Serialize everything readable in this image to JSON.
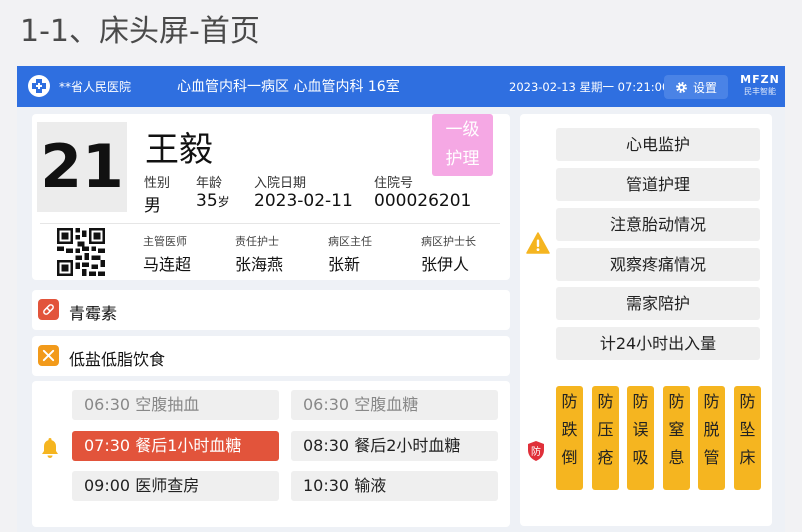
{
  "page_heading": "1-1、床头屏-首页",
  "topbar": {
    "hospital": "**省人民医院",
    "ward": "心血管内科一病区  心血管内科 16室",
    "datetime": "2023-02-13 星期一 07:21:00",
    "settings_label": "设置",
    "brand_main": "MFZN",
    "brand_sub": "民丰智能"
  },
  "patient": {
    "bed_number": "21",
    "name": "王毅",
    "care_level_line1": "一级",
    "care_level_line2": "护理",
    "gender_label": "性别",
    "gender": "男",
    "age_label": "年龄",
    "age": "35",
    "age_unit": "岁",
    "admit_label": "入院日期",
    "admit_date": "2023-02-11",
    "inpatient_label": "住院号",
    "inpatient_no": "000026201"
  },
  "staff": [
    {
      "label": "主管医师",
      "name": "马连超"
    },
    {
      "label": "责任护士",
      "name": "张海燕"
    },
    {
      "label": "病区主任",
      "name": "张新"
    },
    {
      "label": "病区护士长",
      "name": "张伊人"
    }
  ],
  "allergy": {
    "text": "青霉素",
    "icon": "pill-icon",
    "color": "#e2543b"
  },
  "diet": {
    "text": "低盐低脂饮食",
    "icon": "utensils-icon",
    "color": "#f29a1a"
  },
  "schedule": [
    {
      "text": "06:30 空腹抽血",
      "state": "done"
    },
    {
      "text": "06:30 空腹血糖",
      "state": "done"
    },
    {
      "text": "07:30 餐后1小时血糖",
      "state": "current"
    },
    {
      "text": "08:30 餐后2小时血糖",
      "state": "upcoming"
    },
    {
      "text": "09:00 医师查房",
      "state": "upcoming"
    },
    {
      "text": "10:30 输液",
      "state": "upcoming"
    }
  ],
  "care_items": [
    "心电监护",
    "管道护理",
    "注意胎动情况",
    "观察疼痛情况",
    "需家陪护",
    "计24小时出入量"
  ],
  "shield_label": "防",
  "prevention": [
    [
      "防",
      "跌",
      "倒"
    ],
    [
      "防",
      "压",
      "疮"
    ],
    [
      "防",
      "误",
      "吸"
    ],
    [
      "防",
      "窒",
      "息"
    ],
    [
      "防",
      "脱",
      "管"
    ],
    [
      "防",
      "坠",
      "床"
    ]
  ],
  "colors": {
    "topbar": "#2f6fe0",
    "badge": "#f5a8e4",
    "active": "#e2543b",
    "warning": "#f5b520",
    "shield": "#e0303a"
  }
}
